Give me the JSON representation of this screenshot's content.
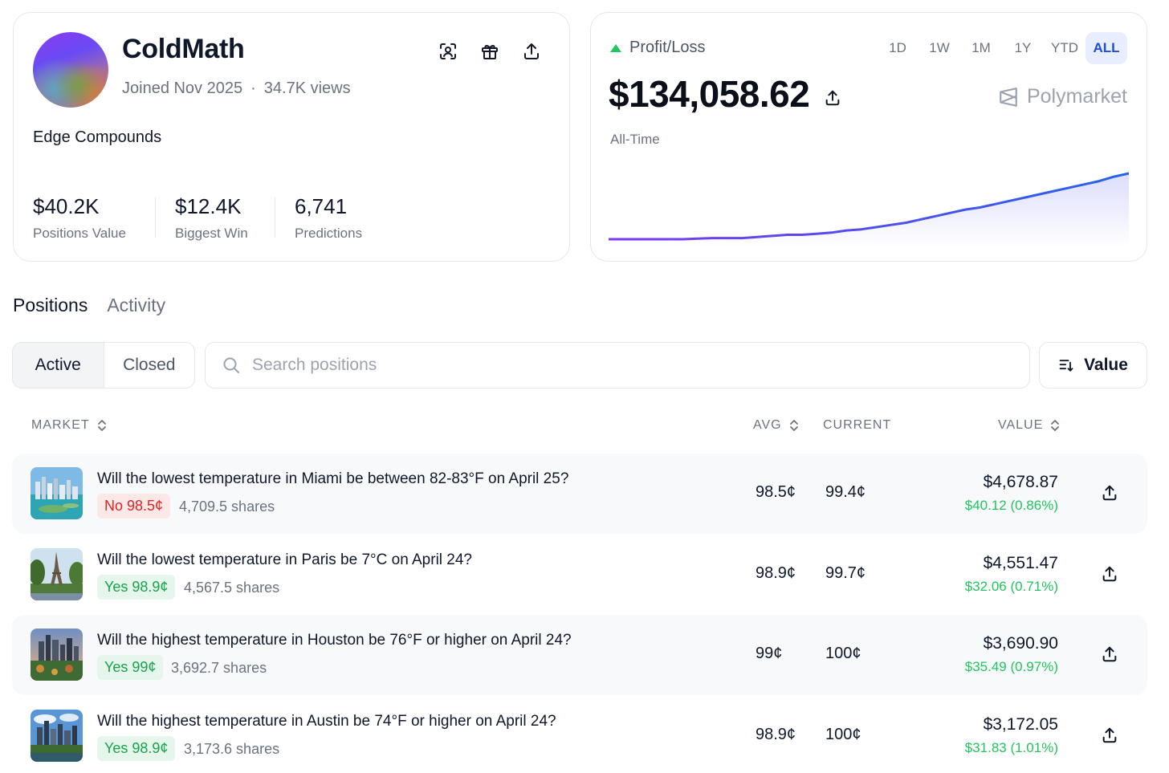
{
  "profile": {
    "username": "ColdMath",
    "joined": "Joined Nov 2025",
    "views": "34.7K views",
    "bio": "Edge Compounds",
    "stats": [
      {
        "value": "$40.2K",
        "label": "Positions Value"
      },
      {
        "value": "$12.4K",
        "label": "Biggest Win"
      },
      {
        "value": "6,741",
        "label": "Predictions"
      }
    ],
    "icons": [
      "scan-user-icon",
      "gift-icon",
      "share-icon"
    ]
  },
  "pnl": {
    "label": "Profit/Loss",
    "value": "$134,058.62",
    "period_label": "All-Time",
    "brand": "Polymarket",
    "ranges": [
      "1D",
      "1W",
      "1M",
      "1Y",
      "YTD",
      "ALL"
    ],
    "active_range": "ALL",
    "colors": {
      "line_start": "#7c3aed",
      "line_end": "#2563eb",
      "up": "#22c55e"
    }
  },
  "chart_data": {
    "type": "area",
    "title": "",
    "xlabel": "",
    "ylabel": "",
    "grid": false,
    "series": [
      {
        "values": [
          0,
          0,
          0,
          0,
          0,
          0,
          0.5,
          1,
          1,
          1,
          2,
          3,
          4,
          4,
          5,
          6,
          8,
          9,
          11,
          13,
          15,
          18,
          21,
          24,
          27,
          29,
          32,
          35,
          38,
          41,
          44,
          47,
          50,
          53,
          57,
          60
        ]
      }
    ]
  },
  "tabs": {
    "positions": "Positions",
    "activity": "Activity",
    "active": "Positions"
  },
  "filters": {
    "active": "Active",
    "closed": "Closed",
    "search_placeholder": "Search positions",
    "sort_label": "Value"
  },
  "table": {
    "headers": {
      "market": "MARKET",
      "avg": "AVG",
      "current": "CURRENT",
      "value": "VALUE"
    },
    "rows": [
      {
        "title": "Will the lowest temperature in Miami be between 82-83°F on April 25?",
        "outcome": "No 98.5¢",
        "outcome_type": "no",
        "shares": "4,709.5 shares",
        "avg": "98.5¢",
        "current": "99.4¢",
        "value": "$4,678.87",
        "change": "$40.12 (0.86%)",
        "thumb": "miami"
      },
      {
        "title": "Will the lowest temperature in Paris be 7°C on April 24?",
        "outcome": "Yes 98.9¢",
        "outcome_type": "yes",
        "shares": "4,567.5 shares",
        "avg": "98.9¢",
        "current": "99.7¢",
        "value": "$4,551.47",
        "change": "$32.06 (0.71%)",
        "thumb": "paris"
      },
      {
        "title": "Will the highest temperature in Houston be 76°F or higher on April 24?",
        "outcome": "Yes 99¢",
        "outcome_type": "yes",
        "shares": "3,692.7 shares",
        "avg": "99¢",
        "current": "100¢",
        "value": "$3,690.90",
        "change": "$35.49 (0.97%)",
        "thumb": "houston"
      },
      {
        "title": "Will the highest temperature in Austin be 74°F or higher on April 24?",
        "outcome": "Yes 98.9¢",
        "outcome_type": "yes",
        "shares": "3,173.6 shares",
        "avg": "98.9¢",
        "current": "100¢",
        "value": "$3,172.05",
        "change": "$31.83 (1.01%)",
        "thumb": "austin"
      }
    ]
  }
}
